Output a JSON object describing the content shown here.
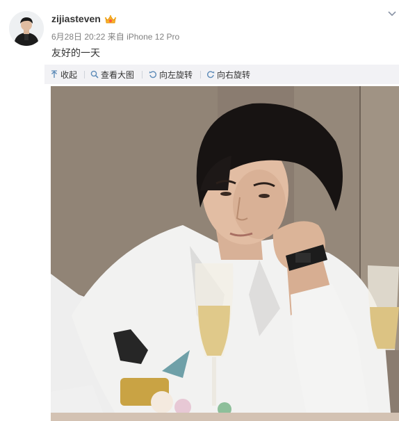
{
  "post": {
    "username": "zijiasteven",
    "badge_icon": "member-crown-badge-icon",
    "meta": {
      "date": "6月28日 20:22",
      "source": "来自 iPhone 12 Pro"
    },
    "text": "友好的一天",
    "menu_icon": "chevron-down-icon"
  },
  "toolbar": {
    "items": [
      {
        "label": "收起",
        "icon": "collapse-up-arrow-icon"
      },
      {
        "label": "查看大图",
        "icon": "magnifier-icon"
      },
      {
        "label": "向左旋转",
        "icon": "rotate-left-icon"
      },
      {
        "label": "向右旋转",
        "icon": "rotate-right-icon"
      }
    ]
  },
  "photo": {
    "subject": "young man in white shirt leaning head on hand at dinner table with champagne glasses"
  },
  "colors": {
    "text": "#333333",
    "meta": "#808080",
    "toolbar_bg": "#f2f2f5",
    "icon_blue": "#5d8bb8"
  }
}
